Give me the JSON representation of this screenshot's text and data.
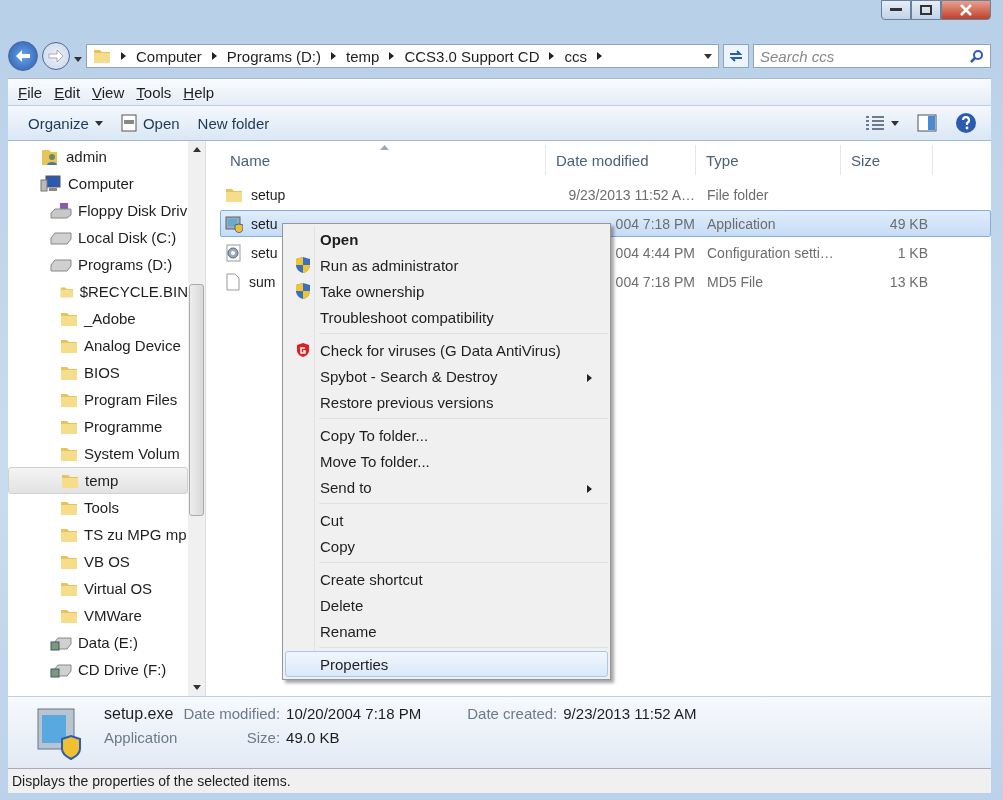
{
  "address_bar": {
    "segments": [
      "Computer",
      "Programs (D:)",
      "temp",
      "CCS3.0 Support CD",
      "ccs"
    ]
  },
  "search": {
    "placeholder": "Search ccs"
  },
  "menu_bar": [
    "File",
    "Edit",
    "View",
    "Tools",
    "Help"
  ],
  "toolbar": [
    {
      "label": "Organize",
      "kind": "dropdown"
    },
    {
      "label": "Open",
      "kind": "icon"
    },
    {
      "label": "New folder",
      "kind": "plain"
    }
  ],
  "nav_tree": [
    {
      "label": "admin",
      "kind": "user",
      "selected": false
    },
    {
      "label": "Computer",
      "kind": "computer",
      "selected": false,
      "children": [
        {
          "label": "Floppy Disk Driv",
          "kind": "floppy",
          "selected": false
        },
        {
          "label": "Local Disk (C:)",
          "kind": "drive",
          "selected": false
        },
        {
          "label": "Programs (D:)",
          "kind": "drive",
          "selected": false,
          "children": [
            {
              "label": "$RECYCLE.BIN",
              "kind": "folder",
              "selected": false
            },
            {
              "label": "_Adobe",
              "kind": "folder",
              "selected": false
            },
            {
              "label": "Analog Device",
              "kind": "folder",
              "selected": false
            },
            {
              "label": "BIOS",
              "kind": "folder",
              "selected": false
            },
            {
              "label": "Program Files",
              "kind": "folder",
              "selected": false
            },
            {
              "label": "Programme",
              "kind": "folder",
              "selected": false
            },
            {
              "label": "System Volum",
              "kind": "folder",
              "selected": false
            },
            {
              "label": "temp",
              "kind": "folder",
              "selected": true
            },
            {
              "label": "Tools",
              "kind": "folder",
              "selected": false
            },
            {
              "label": "TS zu MPG mp",
              "kind": "folder",
              "selected": false
            },
            {
              "label": "VB OS",
              "kind": "folder",
              "selected": false
            },
            {
              "label": "Virtual OS",
              "kind": "folder",
              "selected": false
            },
            {
              "label": "VMWare",
              "kind": "folder",
              "selected": false
            }
          ]
        },
        {
          "label": "Data (E:)",
          "kind": "netdrive",
          "selected": false
        },
        {
          "label": "CD Drive (F:)",
          "kind": "netdrive",
          "selected": false
        }
      ]
    }
  ],
  "columns": [
    "Name",
    "Date modified",
    "Type",
    "Size"
  ],
  "files": [
    {
      "name": "setup",
      "kind": "folder",
      "date": "9/23/2013 11:52 A…",
      "type": "File folder",
      "selected": false
    },
    {
      "name": "setu",
      "kind": "exe",
      "date": "004 7:18 PM",
      "type": "Application",
      "size": "49 KB",
      "selected": true
    },
    {
      "name": "setu",
      "kind": "config",
      "date": "004 4:44 PM",
      "type": "Configuration setti…",
      "size": "1 KB",
      "selected": false
    },
    {
      "name": "sum",
      "kind": "file",
      "date": "004 7:18 PM",
      "type": "MD5 File",
      "size": "13 KB",
      "selected": false
    }
  ],
  "context_menu": [
    {
      "kind": "item",
      "label": "Open",
      "default": true,
      "hovered": false
    },
    {
      "kind": "admin_item",
      "label": "Run as administrator",
      "hovered": false
    },
    {
      "kind": "admin_item",
      "label": "Take ownership",
      "hovered": false
    },
    {
      "kind": "item",
      "label": "Troubleshoot compatibility",
      "hovered": false
    },
    {
      "kind": "separator"
    },
    {
      "kind": "antivirus_item",
      "label": "Check for viruses (G Data AntiVirus)",
      "hovered": false
    },
    {
      "kind": "item",
      "label": "Spybot - Search & Destroy",
      "submenu": true,
      "hovered": false
    },
    {
      "kind": "item",
      "label": "Restore previous versions",
      "hovered": false
    },
    {
      "kind": "separator"
    },
    {
      "kind": "item",
      "label": "Copy To folder...",
      "hovered": false
    },
    {
      "kind": "item",
      "label": "Move To folder...",
      "hovered": false
    },
    {
      "kind": "item",
      "label": "Send to",
      "submenu": true,
      "hovered": false
    },
    {
      "kind": "separator"
    },
    {
      "kind": "item",
      "label": "Cut",
      "hovered": false
    },
    {
      "kind": "item",
      "label": "Copy",
      "hovered": false
    },
    {
      "kind": "separator"
    },
    {
      "kind": "item",
      "label": "Create shortcut",
      "hovered": false
    },
    {
      "kind": "item",
      "label": "Delete",
      "hovered": false
    },
    {
      "kind": "item",
      "label": "Rename",
      "hovered": false
    },
    {
      "kind": "separator"
    },
    {
      "kind": "item",
      "label": "Properties",
      "hovered": true
    }
  ],
  "details": {
    "name": "setup.exe",
    "type": "Application",
    "fields": [
      {
        "label": "Date modified:",
        "value": "10/20/2004 7:18 PM"
      },
      {
        "label": "Date created:",
        "value": "9/23/2013 11:52 AM"
      },
      {
        "label": "Size:",
        "value": "49.0 KB"
      }
    ]
  },
  "status_bar": "Displays the properties of the selected items."
}
